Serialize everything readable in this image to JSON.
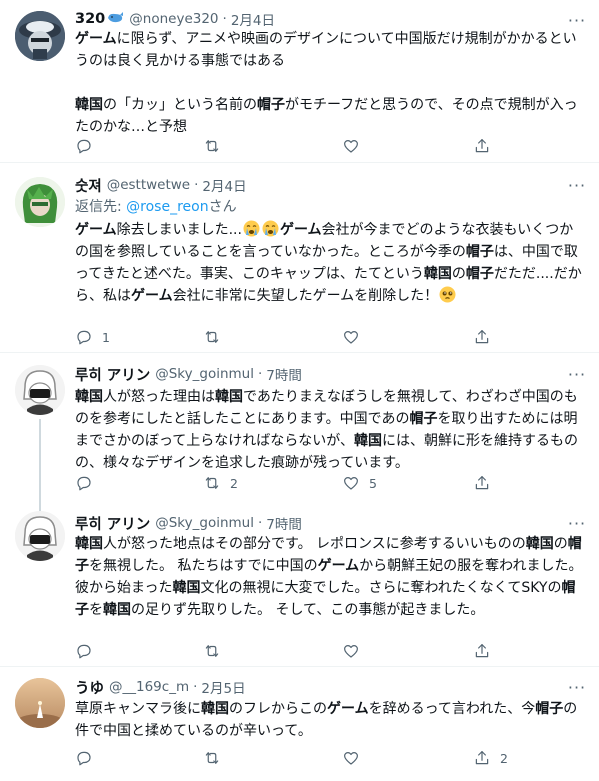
{
  "tweets": [
    {
      "name": "320",
      "handle": "@noneye320",
      "sep": "·",
      "date": "2月4日",
      "more": "···",
      "reply_prefix": "",
      "reply_handle": "",
      "reply_suffix": "",
      "segments": [
        {
          "b": true,
          "t": "ゲーム"
        },
        {
          "b": false,
          "t": "に限らず、アニメや映画のデザインについて中国版だけ規制がかかるというのは良く見かける事態ではある\n\n"
        },
        {
          "b": true,
          "t": "韓国"
        },
        {
          "b": false,
          "t": "の「カッ」という名前の"
        },
        {
          "b": true,
          "t": "帽子"
        },
        {
          "b": false,
          "t": "がモチーフだと思うので、その点で規制が入ったのかな…と予想"
        }
      ],
      "counts": {
        "reply": "",
        "retweet": "",
        "like": "",
        "share": ""
      }
    },
    {
      "name": "숫져",
      "handle": "@esttwetwe",
      "sep": "·",
      "date": "2月4日",
      "more": "···",
      "reply_prefix": "返信先: ",
      "reply_handle": "@rose_reon",
      "reply_suffix": "さん",
      "segments": [
        {
          "b": true,
          "t": "ゲーム"
        },
        {
          "b": false,
          "t": "除去しまいました..."
        },
        {
          "emoji": "crying-face"
        },
        {
          "emoji": "crying-face"
        },
        {
          "b": true,
          "t": "ゲーム"
        },
        {
          "b": false,
          "t": "会社が今までどのような衣装もいくつかの国を参照していることを言っていなかった。ところが今季の"
        },
        {
          "b": true,
          "t": "帽子"
        },
        {
          "b": false,
          "t": "は、中国で取ってきたと述べた。事実、このキャップは、たてという"
        },
        {
          "b": true,
          "t": "韓国"
        },
        {
          "b": false,
          "t": "の"
        },
        {
          "b": true,
          "t": "帽子"
        },
        {
          "b": false,
          "t": "だただ....だから、私は"
        },
        {
          "b": true,
          "t": "ゲーム"
        },
        {
          "b": false,
          "t": "会社に非常に失望したゲームを削除した！"
        },
        {
          "emoji": "pleading-face"
        }
      ],
      "counts": {
        "reply": "1",
        "retweet": "",
        "like": "",
        "share": ""
      }
    },
    {
      "name": "루히 アリン",
      "handle": "@Sky_goinmul",
      "sep": "·",
      "date": "7時間",
      "more": "···",
      "reply_prefix": "",
      "reply_handle": "",
      "reply_suffix": "",
      "segments": [
        {
          "b": true,
          "t": "韓国"
        },
        {
          "b": false,
          "t": "人が怒った理由は"
        },
        {
          "b": true,
          "t": "韓国"
        },
        {
          "b": false,
          "t": "であたりまえなぼうしを無視して、わざわざ中国のものを参考にしたと話したことにあります。中国であの"
        },
        {
          "b": true,
          "t": "帽子"
        },
        {
          "b": false,
          "t": "を取り出すためには明までさかのぼって上らなければならないが、"
        },
        {
          "b": true,
          "t": "韓国"
        },
        {
          "b": false,
          "t": "には、朝鮮に形を維持するものの、様々なデザインを追求した痕跡が残っています。"
        }
      ],
      "counts": {
        "reply": "",
        "retweet": "2",
        "like": "5",
        "share": ""
      }
    },
    {
      "name": "루히 アリン",
      "handle": "@Sky_goinmul",
      "sep": "·",
      "date": "7時間",
      "more": "···",
      "reply_prefix": "",
      "reply_handle": "",
      "reply_suffix": "",
      "segments": [
        {
          "b": true,
          "t": "韓国"
        },
        {
          "b": false,
          "t": "人が怒った地点はその部分です。 レポロンスに参考するいいものの"
        },
        {
          "b": true,
          "t": "韓国"
        },
        {
          "b": false,
          "t": "の"
        },
        {
          "b": true,
          "t": "帽子"
        },
        {
          "b": false,
          "t": "を無視した。 私たちはすでに中国の"
        },
        {
          "b": true,
          "t": "ゲーム"
        },
        {
          "b": false,
          "t": "から朝鮮王妃の服を奪われました。 彼から始まった"
        },
        {
          "b": true,
          "t": "韓国"
        },
        {
          "b": false,
          "t": "文化の無視に大変でした。さらに奪われたくなくてSKYの"
        },
        {
          "b": true,
          "t": "帽子"
        },
        {
          "b": false,
          "t": "を"
        },
        {
          "b": true,
          "t": "韓国"
        },
        {
          "b": false,
          "t": "の足りず先取りした。 そして、この事態が起きました。"
        }
      ],
      "counts": {
        "reply": "",
        "retweet": "",
        "like": "",
        "share": ""
      }
    },
    {
      "name": "うゆ",
      "handle": "@__169c_m",
      "sep": "·",
      "date": "2月5日",
      "more": "···",
      "reply_prefix": "",
      "reply_handle": "",
      "reply_suffix": "",
      "segments": [
        {
          "b": false,
          "t": "草原キャンマラ後に"
        },
        {
          "b": true,
          "t": "韓国"
        },
        {
          "b": false,
          "t": "のフレからこの"
        },
        {
          "b": true,
          "t": "ゲーム"
        },
        {
          "b": false,
          "t": "を辞めるって言われた、今"
        },
        {
          "b": true,
          "t": "帽子"
        },
        {
          "b": false,
          "t": "の件で中国と揉めているのが辛いって。"
        }
      ],
      "counts": {
        "reply": "",
        "retweet": "",
        "like": "",
        "share": "2"
      }
    }
  ]
}
